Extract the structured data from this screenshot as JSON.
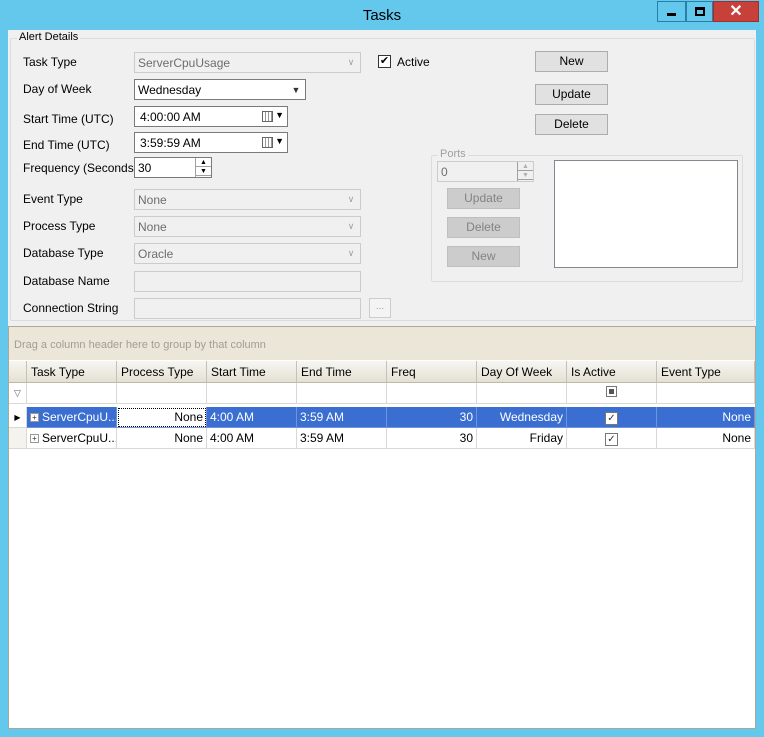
{
  "window": {
    "title": "Tasks"
  },
  "alert_details": {
    "legend": "Alert Details",
    "labels": {
      "task_type": "Task Type",
      "day_of_week": "Day of Week",
      "start_time": "Start Time (UTC)",
      "end_time": "End Time (UTC)",
      "frequency": "Frequency (Seconds)",
      "event_type": "Event Type",
      "process_type": "Process Type",
      "database_type": "Database Type",
      "database_name": "Database Name",
      "connection_string": "Connection String"
    },
    "values": {
      "task_type": "ServerCpuUsage",
      "day_of_week": "Wednesday",
      "start_time": "4:00:00 AM",
      "end_time": "3:59:59 AM",
      "frequency": "30",
      "event_type": "None",
      "process_type": "None",
      "database_type": "Oracle",
      "database_name": "",
      "connection_string": ""
    },
    "active": {
      "label": "Active",
      "checked": true
    },
    "ellipsis_label": "...",
    "buttons": {
      "new": "New",
      "update": "Update",
      "delete": "Delete"
    }
  },
  "ports": {
    "legend": "Ports",
    "value": "0",
    "buttons": {
      "update": "Update",
      "delete": "Delete",
      "new": "New"
    }
  },
  "grid": {
    "group_panel_text": "Drag a column header here to group by that column",
    "columns": [
      "Task Type",
      "Process Type",
      "Start Time",
      "End Time",
      "Freq",
      "Day Of Week",
      "Is Active",
      "Event Type"
    ],
    "rows": [
      {
        "task_type": "ServerCpuU...",
        "process_type": "None",
        "start_time": "4:00 AM",
        "end_time": "3:59 AM",
        "freq": "30",
        "day_of_week": "Wednesday",
        "is_active": true,
        "event_type": "None",
        "selected": true
      },
      {
        "task_type": "ServerCpuU...",
        "process_type": "None",
        "start_time": "4:00 AM",
        "end_time": "3:59 AM",
        "freq": "30",
        "day_of_week": "Friday",
        "is_active": true,
        "event_type": "None",
        "selected": false
      }
    ]
  }
}
